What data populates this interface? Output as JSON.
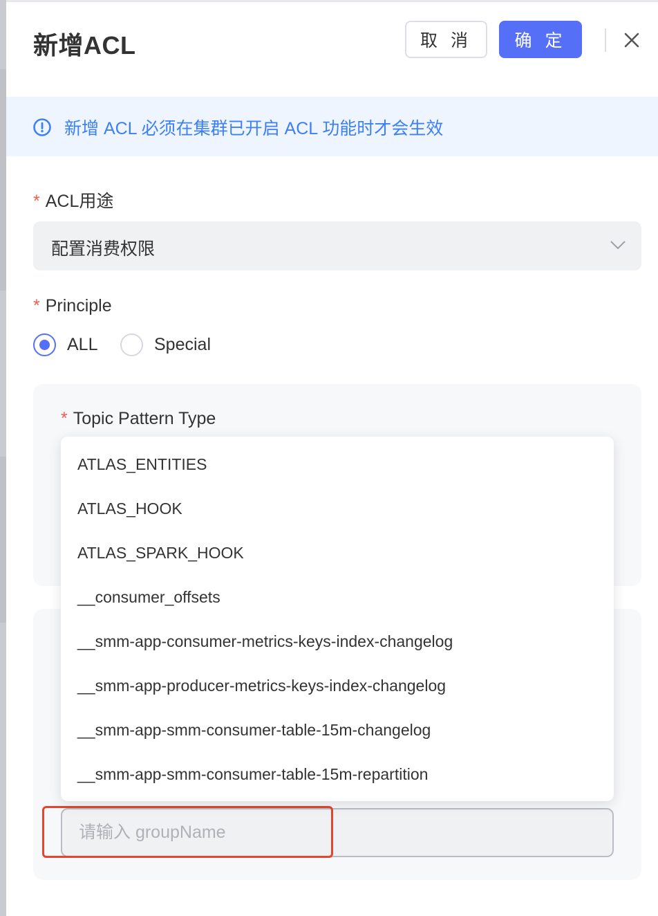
{
  "dialog": {
    "title": "新增ACL",
    "cancel_label": "取 消",
    "ok_label": "确 定"
  },
  "alert": {
    "text": "新增 ACL 必须在集群已开启 ACL 功能时才会生效"
  },
  "form": {
    "acl_usage": {
      "required_mark": "*",
      "label": "ACL用途",
      "value": "配置消费权限"
    },
    "principle": {
      "required_mark": "*",
      "label": "Principle",
      "options": [
        "ALL",
        "Special"
      ],
      "selected": "ALL"
    },
    "topic_pattern_type": {
      "required_mark": "*",
      "label": "Topic Pattern Type"
    },
    "group_name": {
      "placeholder": "请输入 groupName",
      "value": ""
    }
  },
  "dropdown": {
    "items": [
      "ATLAS_ENTITIES",
      "ATLAS_HOOK",
      "ATLAS_SPARK_HOOK",
      "__consumer_offsets",
      "__smm-app-consumer-metrics-keys-index-changelog",
      "__smm-app-producer-metrics-keys-index-changelog",
      "__smm-app-smm-consumer-table-15m-changelog",
      "__smm-app-smm-consumer-table-15m-repartition"
    ]
  },
  "colors": {
    "primary": "#556ff6",
    "alert_text": "#3d7ff4",
    "alert_bg": "#eef5fe",
    "required": "#f25c4a",
    "highlight_border": "#e8432c"
  },
  "icons": {
    "close": "close-icon",
    "alert": "info-circle-icon",
    "select_arrow": "chevron-down-icon"
  }
}
